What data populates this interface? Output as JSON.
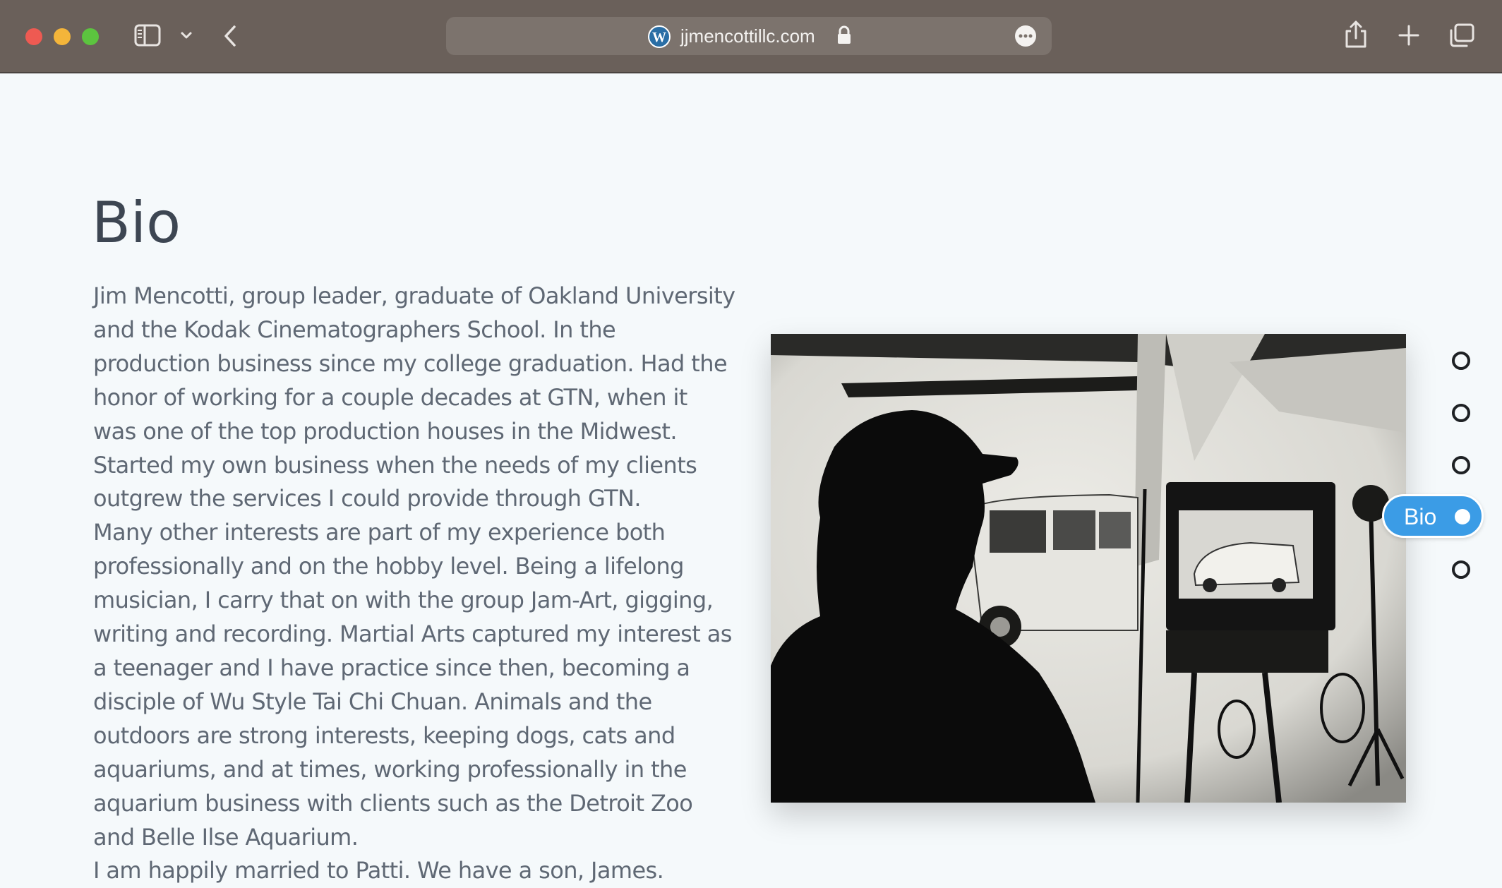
{
  "browser": {
    "url": "jjmencottillc.com",
    "icons": [
      "sidebar-icon",
      "chevron-down-icon",
      "back-icon",
      "wordpress-icon",
      "lock-icon",
      "more-icon",
      "share-icon",
      "plus-icon",
      "tabs-icon"
    ]
  },
  "page": {
    "title": "Bio",
    "paragraphs": [
      "Jim Mencotti, group leader, graduate of Oakland University and the Kodak Cinematographers School. In the production business since my college graduation. Had the honor of working for a couple decades at GTN, when it was one of the top production houses in the Midwest.",
      "Started my own business when the needs of my clients outgrew the services I could provide through GTN.",
      "Many other interests are part of my experience both professionally and on the hobby level. Being a lifelong musician, I carry that on with the group Jam-Art, gigging, writing and recording. Martial Arts captured my interest as a teenager and I have practice since then, becoming a disciple of Wu Style Tai Chi Chuan. Animals and the outdoors are strong interests, keeping dogs, cats and aquariums, and at times, working professionally in the aquarium business with clients such as the Detroit Zoo and Belle Ilse Aquarium.",
      "I am happily married to Patti. We have a son, James."
    ]
  },
  "section_nav": {
    "active_label": "Bio",
    "active_index": 3,
    "count": 5
  },
  "colors": {
    "accent": "#3b9ce6",
    "toolbar": "#6a605a",
    "page_bg": "#f5f9fb",
    "heading": "#3d4652",
    "body_text": "#5f6874"
  }
}
